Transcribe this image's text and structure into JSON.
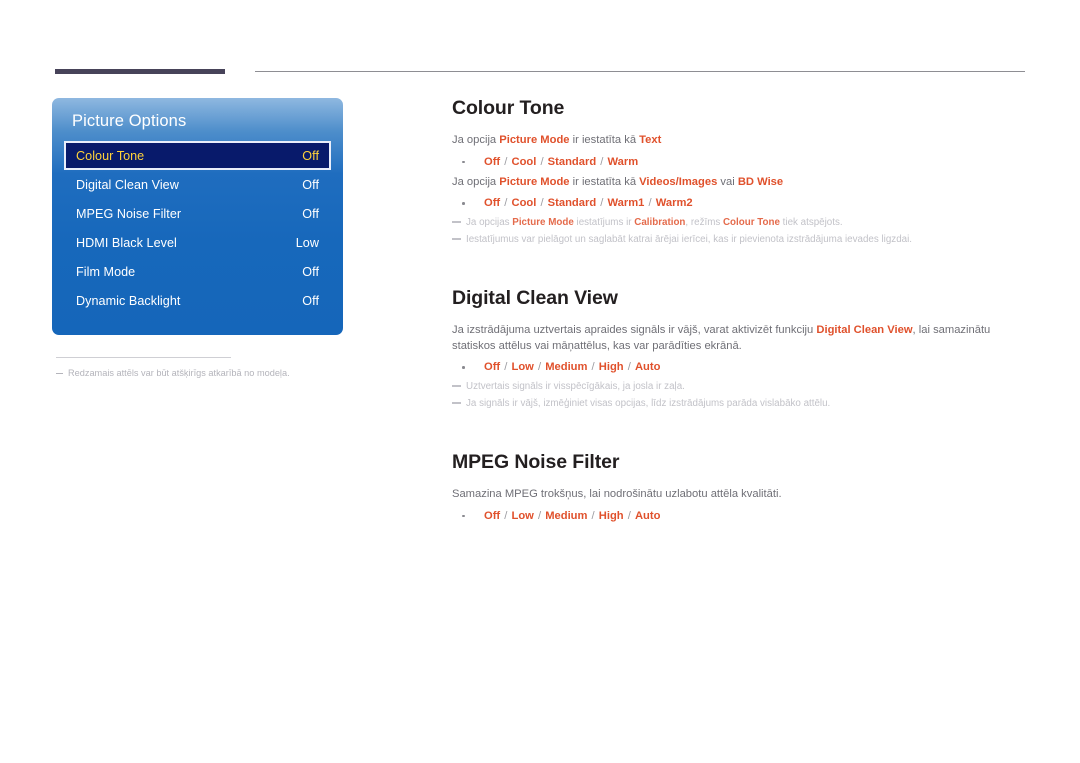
{
  "page": {
    "language": "lv",
    "accent_color": "#e0512c",
    "osd_blue": "#1768bb",
    "osd_selected_bg": "#081a6b",
    "osd_selected_text": "#ffd23a",
    "heading_color": "#231f20",
    "body_color": "#6f6f76",
    "note_color": "#c2c2c8",
    "rule_dark_color": "#474359",
    "rule_thin_color": "#8e8e93"
  },
  "osd": {
    "title": "Picture Options",
    "rows": [
      {
        "label": "Colour Tone",
        "value": "Off",
        "selected": true
      },
      {
        "label": "Digital Clean View",
        "value": "Off",
        "selected": false
      },
      {
        "label": "MPEG Noise Filter",
        "value": "Off",
        "selected": false
      },
      {
        "label": "HDMI Black Level",
        "value": "Low",
        "selected": false
      },
      {
        "label": "Film Mode",
        "value": "Off",
        "selected": false
      },
      {
        "label": "Dynamic Backlight",
        "value": "Off",
        "selected": false
      }
    ],
    "footnote": "Redzamais attēls var būt atšķirīgs atkarībā no modeļa."
  },
  "sections": [
    {
      "title": "Colour Tone",
      "line1_pre": "Ja opcija ",
      "line1_b1": "Picture Mode",
      "line1_mid": " ir iestatīta kā ",
      "line1_b2": "Text",
      "options1": "Off / Cool / Standard / Warm",
      "options1_items": [
        "Off",
        "Cool",
        "Standard",
        "Warm"
      ],
      "line2_pre": "Ja opcija ",
      "line2_b1": "Picture Mode",
      "line2_mid": " ir iestatīta kā ",
      "line2_b2": "Videos/Images",
      "line2_mid2": " vai ",
      "line2_b3": "BD Wise",
      "options2": "Off / Cool / Standard / Warm1 / Warm2",
      "options2_items": [
        "Off",
        "Cool",
        "Standard",
        "Warm1",
        "Warm2"
      ],
      "note1_a": "Ja opcijas ",
      "note1_b1": "Picture Mode",
      "note1_b": " iestatījums ir ",
      "note1_b2": "Calibration",
      "note1_c": ", režīms ",
      "note1_b3": "Colour Tone",
      "note1_d": " tiek atspējots.",
      "note2": "Iestatījumus var pielāgot un saglabāt katrai ārējai ierīcei, kas ir pievienota izstrādājuma ievades ligzdai."
    },
    {
      "title": "Digital Clean View",
      "body_a": "Ja izstrādājuma uztvertais apraides signāls ir vājš, varat aktivizēt funkciju ",
      "body_b": "Digital Clean View",
      "body_c": ", lai samazinātu statiskos attēlus vai māņattēlus, kas var parādīties ekrānā.",
      "options": "Off / Low / Medium / High / Auto",
      "options_items": [
        "Off",
        "Low",
        "Medium",
        "High",
        "Auto"
      ],
      "note1": "Uztvertais signāls ir visspēcīgākais, ja josla ir zaļa.",
      "note2": "Ja signāls ir vājš, izmēģiniet visas opcijas, līdz izstrādājums parāda vislabāko attēlu."
    },
    {
      "title": "MPEG Noise Filter",
      "body": "Samazina MPEG trokšņus, lai nodrošinātu uzlabotu attēla kvalitāti.",
      "options": "Off / Low / Medium / High / Auto",
      "options_items": [
        "Off",
        "Low",
        "Medium",
        "High",
        "Auto"
      ]
    }
  ]
}
